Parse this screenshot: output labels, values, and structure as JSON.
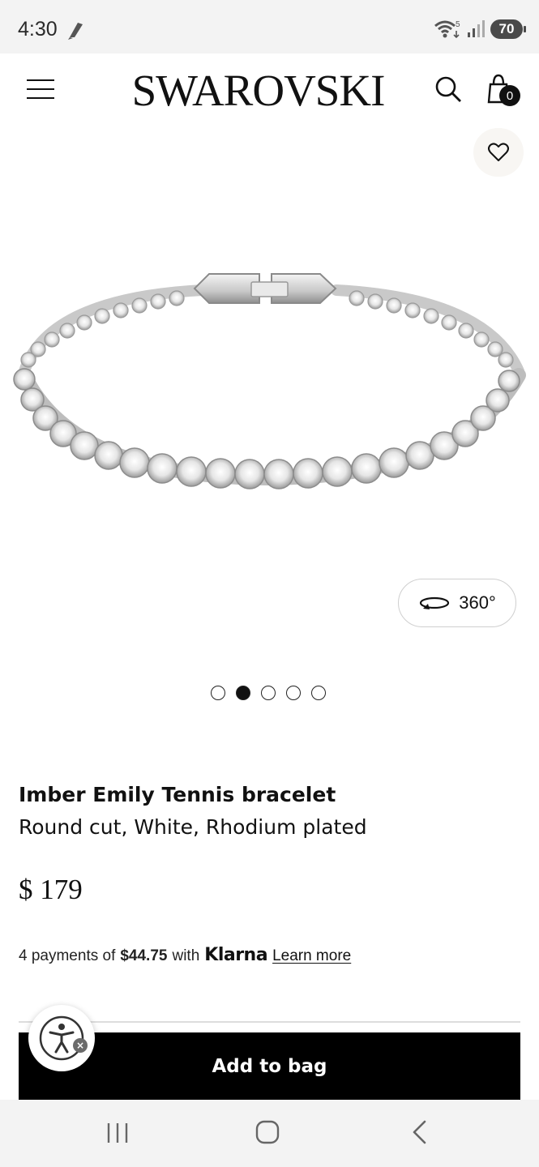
{
  "status_bar": {
    "time": "4:30",
    "battery": "70"
  },
  "header": {
    "brand": "SWAROVSKI",
    "bag_count": "0"
  },
  "gallery": {
    "view_360_label": "360°",
    "dots_total": 5,
    "dots_active_index": 1
  },
  "product": {
    "name": "Imber Emily Tennis bracelet",
    "variant": "Round cut, White, Rhodium plated",
    "price": "$ 179"
  },
  "klarna": {
    "prefix": "4 payments of",
    "amount": "$44.75",
    "with": "with",
    "logo": "Klarna",
    "learn_more": "Learn more"
  },
  "cta": {
    "add_to_bag": "Add to bag"
  },
  "icons": {
    "menu": "menu-icon",
    "search": "search-icon",
    "bag": "bag-icon",
    "wishlist": "heart-icon",
    "rotate": "rotate-360-icon",
    "accessibility": "accessibility-icon"
  }
}
